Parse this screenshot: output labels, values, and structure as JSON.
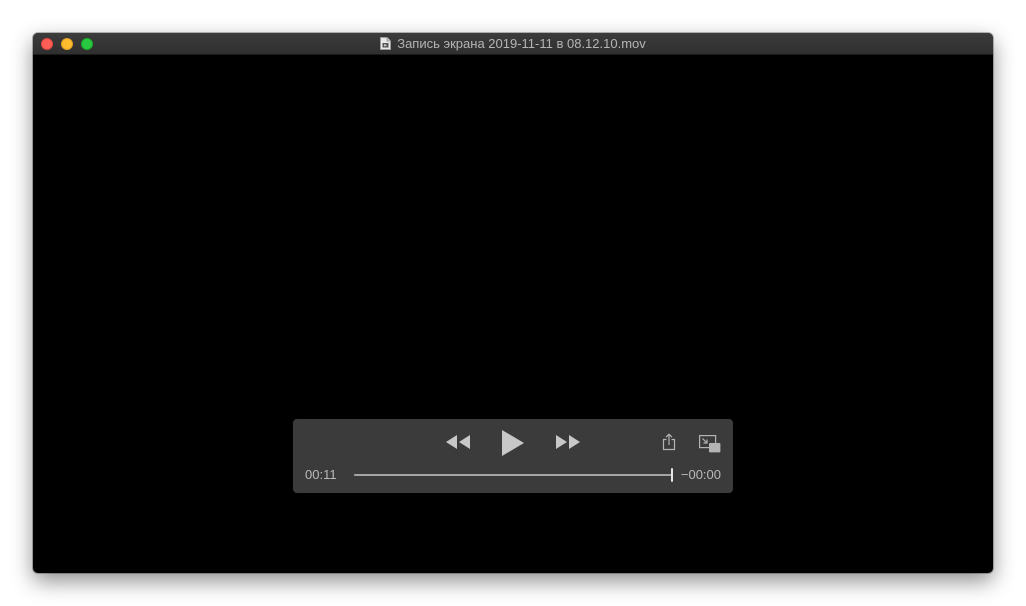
{
  "window": {
    "title": "Запись экрана 2019-11-11 в 08.12.10.mov",
    "title_icon": "document-icon"
  },
  "controls": {
    "rewind_icon": "rewind-icon",
    "play_icon": "play-icon",
    "fast_forward_icon": "fast-forward-icon",
    "share_icon": "share-icon",
    "picture_in_picture_icon": "picture-in-picture-icon",
    "time_current": "00:11",
    "time_remaining": "−00:00",
    "progress": 1.0
  },
  "colors": {
    "close": "#ff5f57",
    "minimize": "#febc2e",
    "zoom": "#28c840",
    "video_background": "#000000"
  }
}
